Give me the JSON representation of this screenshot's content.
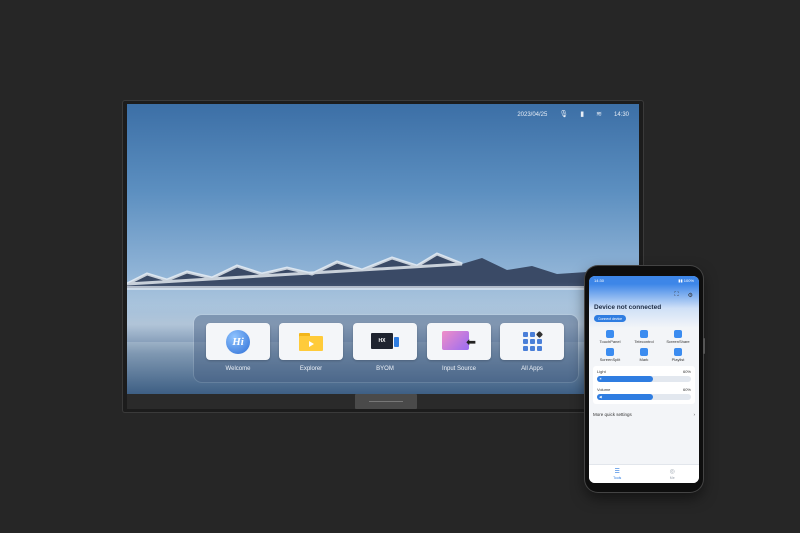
{
  "tv": {
    "status": {
      "date": "2023/04/25",
      "mic_icon": "mic-icon",
      "signal_icon": "signal-icon",
      "wifi_icon": "wifi-icon",
      "time": "14:30"
    },
    "dock": [
      {
        "label": "Welcome",
        "icon": "hi-icon"
      },
      {
        "label": "Explorer",
        "icon": "folder-icon"
      },
      {
        "label": "BYOM",
        "icon": "byom-icon"
      },
      {
        "label": "Input Source",
        "icon": "input-source-icon"
      },
      {
        "label": "All Apps",
        "icon": "grid-icon"
      }
    ]
  },
  "phone": {
    "status_left": "14:30",
    "status_right": "▮▮ 100%",
    "title": "Device not connected",
    "connect_label": "Connect device",
    "tools": [
      {
        "label": "TouchPanel"
      },
      {
        "label": "Telecontrol"
      },
      {
        "label": "ScreenShare"
      },
      {
        "label": "ScreenSplit"
      },
      {
        "label": "Mark"
      },
      {
        "label": "Playlist"
      }
    ],
    "light": {
      "label": "Light",
      "value_text": "60%",
      "level": 0.6
    },
    "volume": {
      "label": "Volume",
      "value_text": "60%",
      "level": 0.6
    },
    "more": "More quick settings",
    "nav": [
      {
        "label": "Tools"
      },
      {
        "label": "Me"
      }
    ]
  }
}
